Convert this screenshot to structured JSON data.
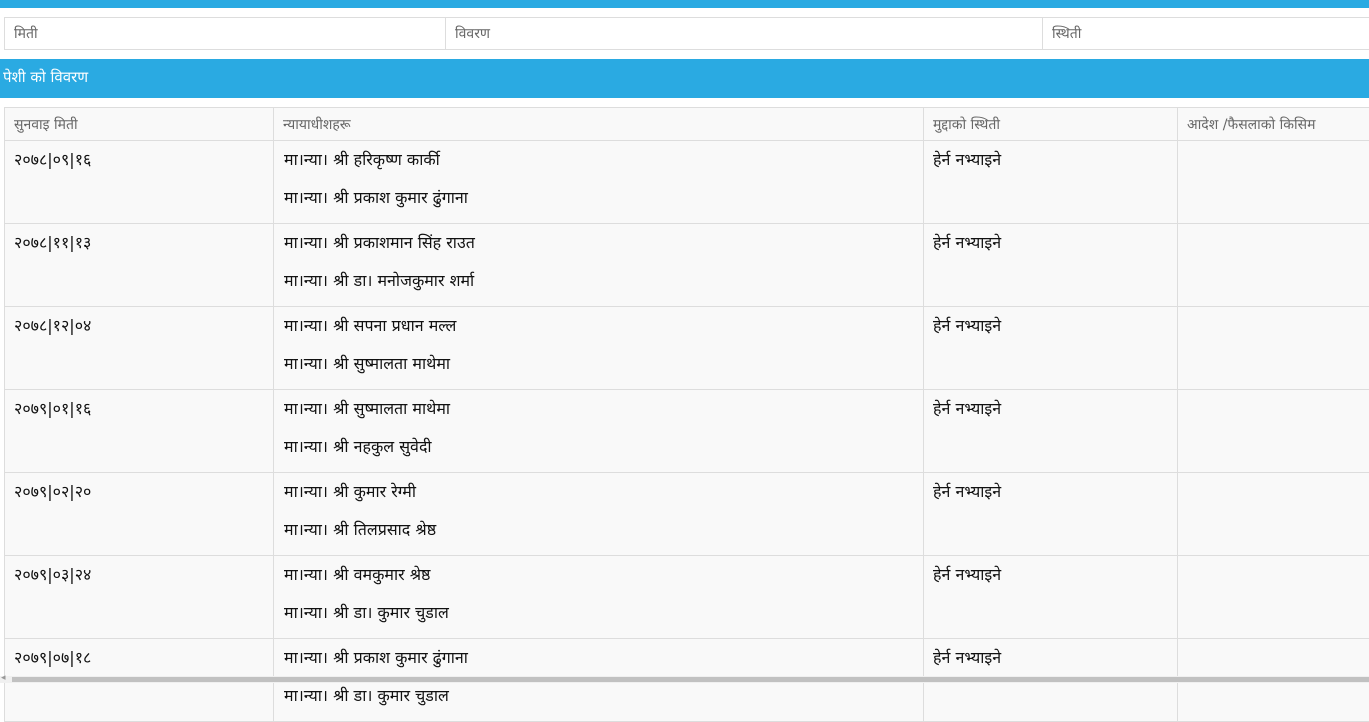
{
  "status_table": {
    "col_date": "मिती",
    "col_detail": "विवरण",
    "col_status": "स्थिती"
  },
  "hearing_section": {
    "title": "पेशी को विवरण",
    "headers": {
      "hearing_date": "सुनवाइ मिती",
      "judges": "न्यायाधीशहरू",
      "case_status": "मुद्दाको स्थिती",
      "order_type": "आदेश /फैसलाको किसिम"
    },
    "rows": [
      {
        "date": "२०७८|०९|१६",
        "judge1": "मा।न्या। श्री हरिकृष्ण कार्की",
        "judge2": "मा।न्या। श्री प्रकाश कुमार ढुंगाना",
        "status": "हेर्न नभ्याइने",
        "order": ""
      },
      {
        "date": "२०७८|११|१३",
        "judge1": "मा।न्या। श्री प्रकाशमान सिंह राउत",
        "judge2": "मा।न्या। श्री डा। मनोजकुमार शर्मा",
        "status": "हेर्न नभ्याइने",
        "order": ""
      },
      {
        "date": "२०७८|१२|०४",
        "judge1": "मा।न्या। श्री सपना प्रधान मल्ल",
        "judge2": "मा।न्या। श्री सुष्मालता माथेमा",
        "status": "हेर्न नभ्याइने",
        "order": ""
      },
      {
        "date": "२०७९|०१|१६",
        "judge1": "मा।न्या। श्री सुष्मालता माथेमा",
        "judge2": "मा।न्या। श्री नहकुल सुवेदी",
        "status": "हेर्न नभ्याइने",
        "order": ""
      },
      {
        "date": "२०७९|०२|२०",
        "judge1": "मा।न्या। श्री कुमार रेग्मी",
        "judge2": "मा।न्या। श्री तिलप्रसाद श्रेष्ठ",
        "status": "हेर्न नभ्याइने",
        "order": ""
      },
      {
        "date": "२०७९|०३|२४",
        "judge1": "मा।न्या। श्री वमकुमार श्रेष्ठ",
        "judge2": "मा।न्या। श्री डा। कुमार चुडाल",
        "status": "हेर्न नभ्याइने",
        "order": ""
      },
      {
        "date": "२०७९|०७|१८",
        "judge1": "मा।न्या। श्री प्रकाश कुमार ढुंगाना",
        "judge2": "मा।न्या। श्री डा। कुमार चुडाल",
        "status": "हेर्न नभ्याइने",
        "order": ""
      }
    ]
  },
  "colors": {
    "accent": "#2aaae2",
    "border": "#dddddd",
    "header_text": "#666666"
  }
}
